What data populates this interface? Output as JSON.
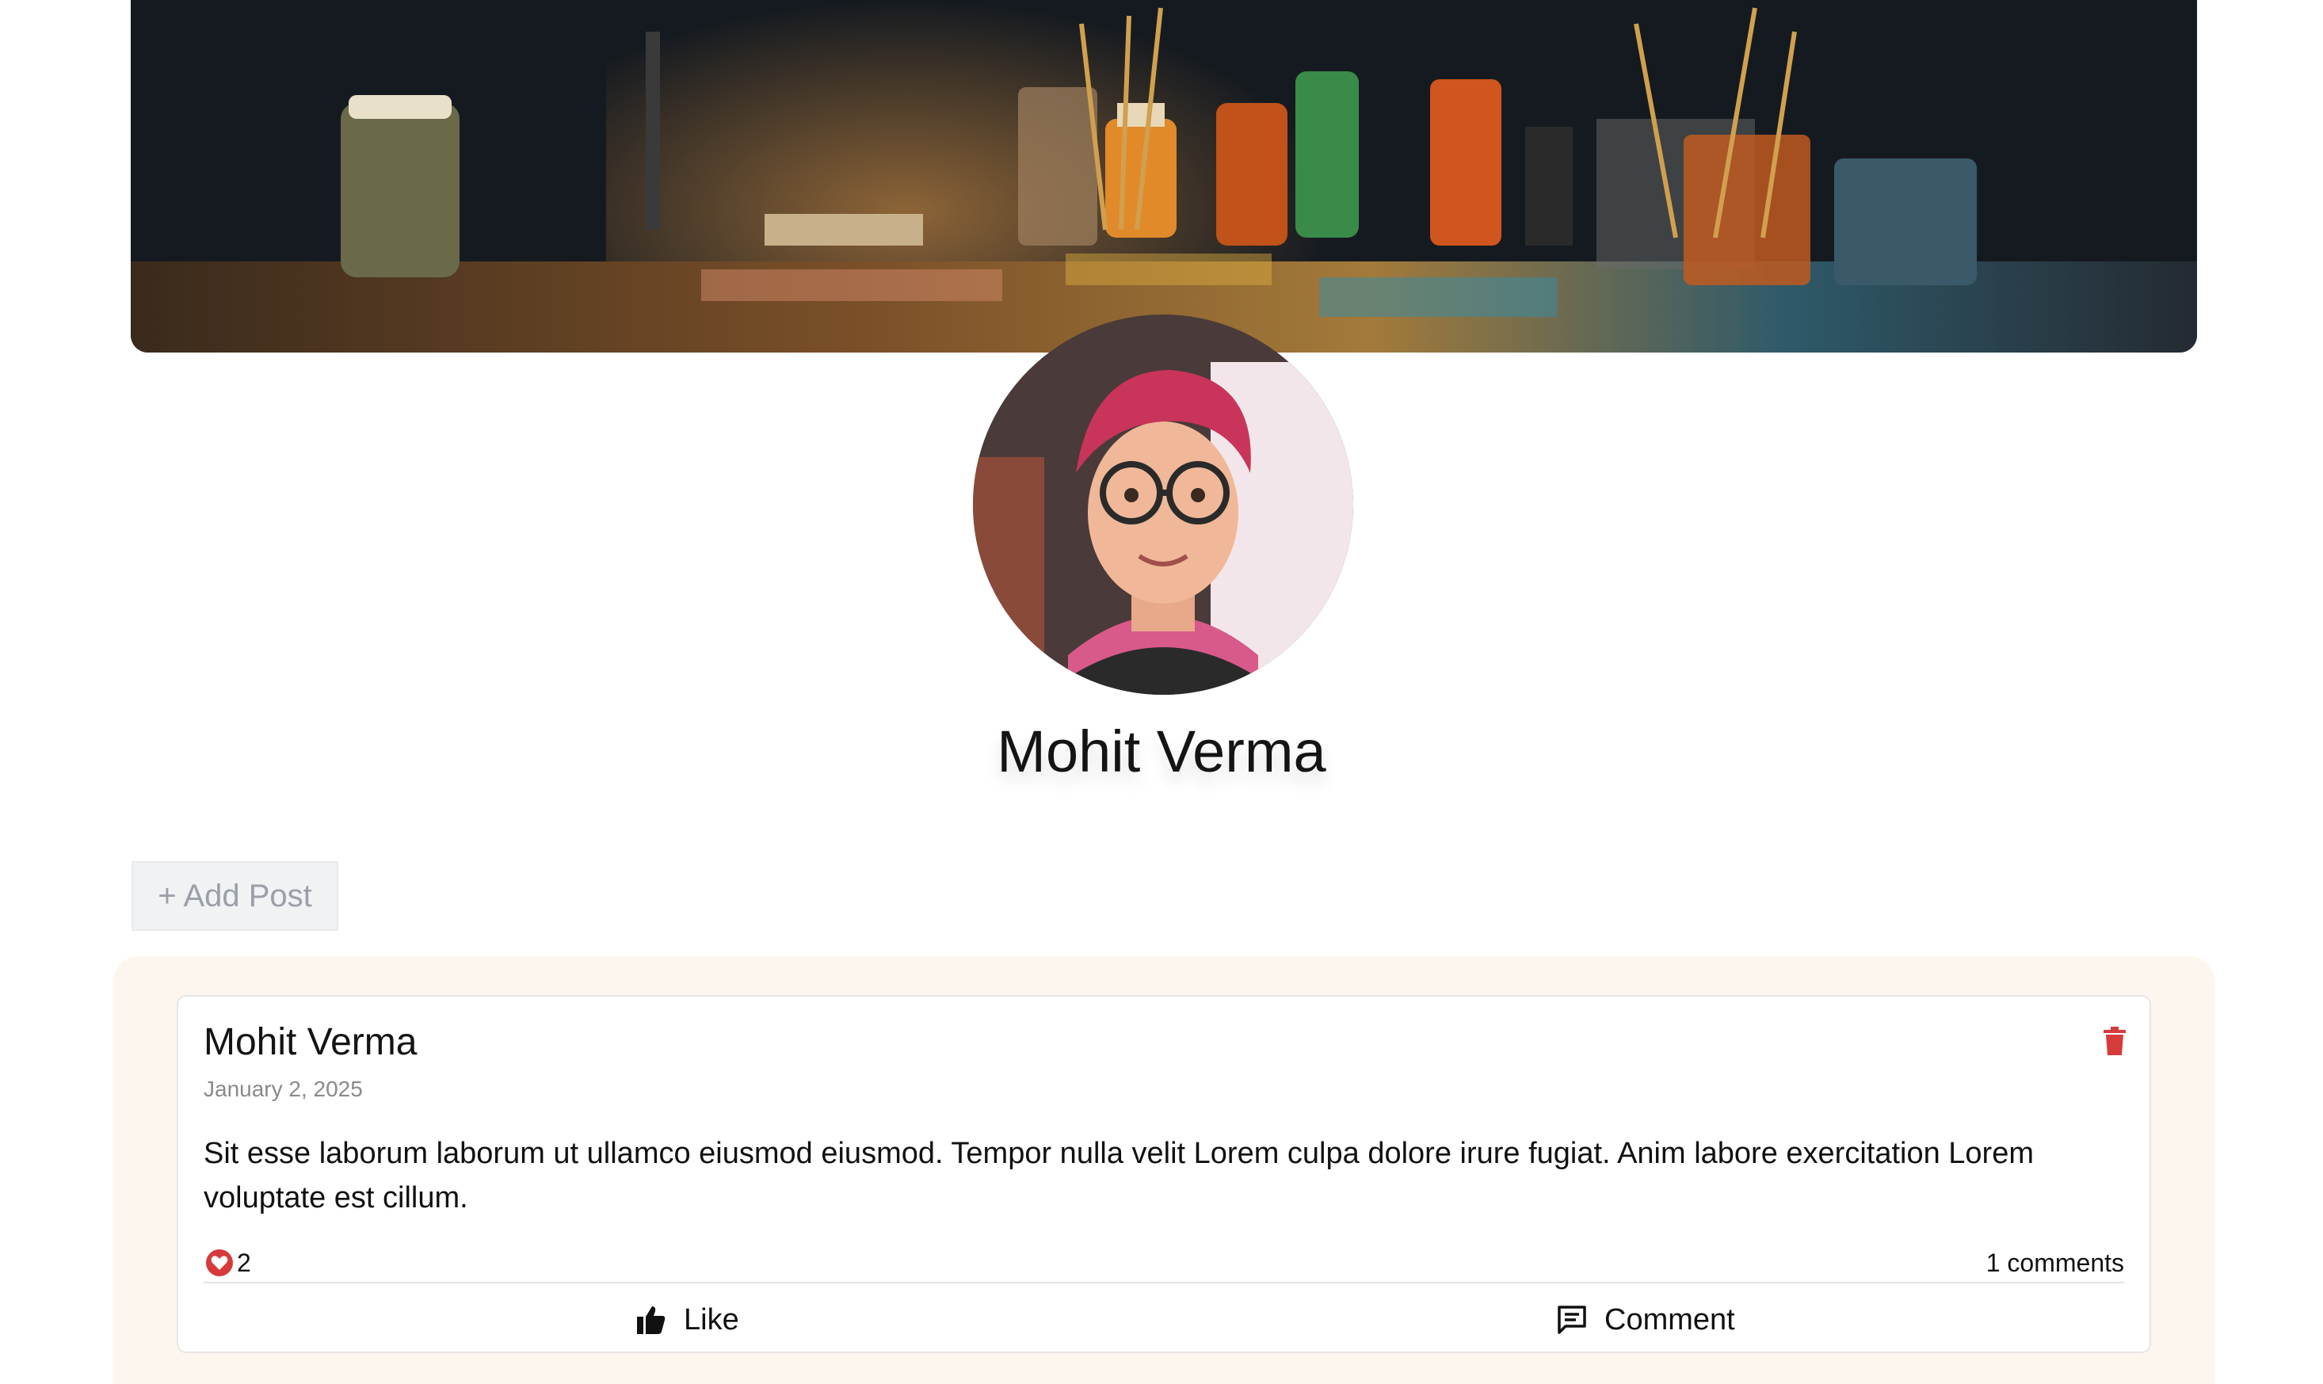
{
  "profile": {
    "name": "Mohit Verma"
  },
  "actions": {
    "add_post_label": "+ Add Post"
  },
  "post": {
    "author": "Mohit Verma",
    "date": "January 2, 2025",
    "body": "Sit esse laborum laborum ut ullamco eiusmod eiusmod. Tempor nulla velit Lorem culpa dolore irure fugiat. Anim labore exercitation Lorem voluptate est cillum.",
    "likes_count": "2",
    "comments_count_label": "1 comments",
    "like_label": "Like",
    "comment_label": "Comment"
  },
  "icons": {
    "delete": "trash-icon",
    "reaction": "heart-icon",
    "like": "thumbs-up-icon",
    "comment": "comment-icon"
  },
  "colors": {
    "feed_background": "#fdf6ee",
    "delete_red": "#d63b3b",
    "heart_red": "#d63b3b",
    "date_gray": "#8a8a8a",
    "add_post_text": "#9aa0a8"
  }
}
